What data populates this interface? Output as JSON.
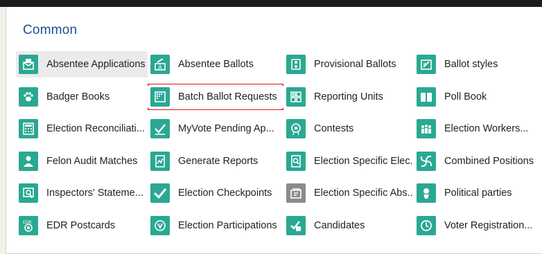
{
  "section": {
    "title": "Common"
  },
  "tiles": [
    {
      "label": "Absentee Applications",
      "icon": "envelope-icon"
    },
    {
      "label": "Absentee Ballots",
      "icon": "ballot-icon"
    },
    {
      "label": "Provisional Ballots",
      "icon": "ballot-box-icon"
    },
    {
      "label": "Ballot styles",
      "icon": "ballot-style-icon"
    },
    {
      "label": "Badger Books",
      "icon": "paw-icon"
    },
    {
      "label": "Batch Ballot Requests",
      "icon": "batch-grid-icon"
    },
    {
      "label": "Reporting Units",
      "icon": "reporting-units-icon"
    },
    {
      "label": "Poll Book",
      "icon": "book-icon"
    },
    {
      "label": "Election Reconciliati...",
      "icon": "calculator-icon"
    },
    {
      "label": "MyVote Pending Ap...",
      "icon": "checkmark-chart-icon"
    },
    {
      "label": "Contests",
      "icon": "trophy-icon"
    },
    {
      "label": "Election Workers...",
      "icon": "workers-icon"
    },
    {
      "label": "Felon Audit Matches",
      "icon": "person-icon"
    },
    {
      "label": "Generate Reports",
      "icon": "report-icon"
    },
    {
      "label": "Election Specific Elec...",
      "icon": "search-doc-icon"
    },
    {
      "label": "Combined Positions",
      "icon": "swirl-icon"
    },
    {
      "label": "Inspectors' Stateme...",
      "icon": "inspector-icon"
    },
    {
      "label": "Election Checkpoints",
      "icon": "checkmark-icon"
    },
    {
      "label": "Election Specific Abs...",
      "icon": "absentee-icon"
    },
    {
      "label": "Political parties",
      "icon": "party-icon"
    },
    {
      "label": "EDR Postcards",
      "icon": "postcard-icon"
    },
    {
      "label": "Election Participations",
      "icon": "vote-badge-icon"
    },
    {
      "label": "Candidates",
      "icon": "candidate-icon"
    },
    {
      "label": "Voter Registration...",
      "icon": "clock-icon"
    }
  ],
  "colors": {
    "accent": "#2aa892",
    "title": "#1d4f91",
    "highlight": "#e3111b"
  }
}
